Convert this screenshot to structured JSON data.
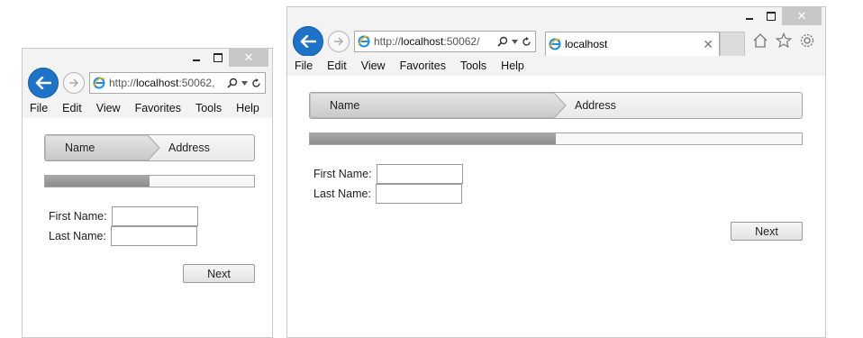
{
  "windows": {
    "small": {
      "address": {
        "prefix": "http://",
        "host": "localhost",
        "suffix": ":50062,"
      },
      "menu": [
        "File",
        "Edit",
        "View",
        "Favorites",
        "Tools",
        "Help"
      ],
      "wizard": {
        "steps": [
          "Name",
          "Address"
        ],
        "progress": 0.5
      },
      "form": {
        "first_name_label": "First Name:",
        "last_name_label": "Last Name:"
      },
      "next_label": "Next"
    },
    "large": {
      "address": {
        "prefix": "http://",
        "host": "localhost",
        "suffix": ":50062/"
      },
      "tab_title": "localhost",
      "menu": [
        "File",
        "Edit",
        "View",
        "Favorites",
        "Tools",
        "Help"
      ],
      "wizard": {
        "steps": [
          "Name",
          "Address"
        ],
        "progress": 0.5
      },
      "form": {
        "first_name_label": "First Name:",
        "last_name_label": "Last Name:"
      },
      "next_label": "Next"
    }
  },
  "colors": {
    "back_button": "#1e73c9",
    "progress_fill": "#969696",
    "close_button": "#c7c7c7"
  },
  "icons": [
    "back-arrow-icon",
    "forward-arrow-icon",
    "ie-logo-icon",
    "search-icon",
    "refresh-icon",
    "home-icon",
    "favorites-star-icon",
    "settings-gear-icon",
    "close-icon",
    "minimize-icon",
    "maximize-icon"
  ]
}
